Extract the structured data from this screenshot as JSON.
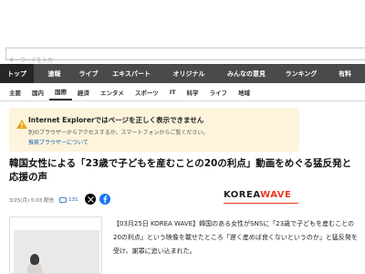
{
  "search": {
    "placeholder": "キーワードを入力"
  },
  "nav_primary": [
    {
      "label": "トップ",
      "active": true
    },
    {
      "label": "速報",
      "active": false
    },
    {
      "label": "ライブ",
      "active": false
    },
    {
      "label": "エキスパート",
      "active": false
    },
    {
      "label": "オリジナル",
      "active": false
    },
    {
      "label": "みんなの意見",
      "active": false
    },
    {
      "label": "ランキング",
      "active": false
    },
    {
      "label": "有料",
      "active": false
    }
  ],
  "nav_secondary": [
    {
      "label": "主要",
      "active": false
    },
    {
      "label": "国内",
      "active": false
    },
    {
      "label": "国際",
      "active": true
    },
    {
      "label": "経済",
      "active": false
    },
    {
      "label": "エンタメ",
      "active": false
    },
    {
      "label": "スポーツ",
      "active": false
    },
    {
      "label": "IT",
      "active": false
    },
    {
      "label": "科学",
      "active": false
    },
    {
      "label": "ライフ",
      "active": false
    },
    {
      "label": "地域",
      "active": false
    }
  ],
  "warning": {
    "title": "Internet Explorerではページを正しく表示できません",
    "text": "別のブラウザーからアクセスするか、スマートフォンからご覧ください。",
    "link": "推奨ブラウザーについて",
    "color": "#fdf4db"
  },
  "article": {
    "headline": "韓国女性による「23歳で子どもを産むことの20の利点」動画をめぐる猛反発と応援の声",
    "date": "3/25(月) 5:03 配信",
    "comment_count": "131",
    "source_logo_a": "KOREA",
    "source_logo_b": "WAVE",
    "body": "【03月25日 KOREA WAVE】韓国のある女性がSNSに「23歳で子どもを産むことの20の利点」という映像を載せたところ「遅く産めば良くないというのか」と猛反発を受け、謝罪に追い込まれた。"
  },
  "colors": {
    "nav_primary_bg": "#4a4a4a",
    "nav_primary_active": "#262626",
    "logo_accent": "#e53a22",
    "link": "#1a5fb4"
  }
}
